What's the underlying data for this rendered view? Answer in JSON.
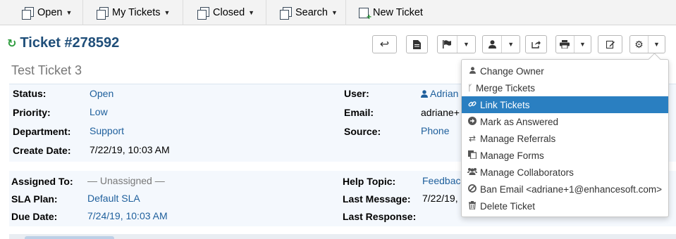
{
  "nav": {
    "open": "Open",
    "my_tickets": "My Tickets",
    "closed": "Closed",
    "search": "Search",
    "new_ticket": "New Ticket"
  },
  "ticket": {
    "number": "Ticket #278592",
    "subject": "Test Ticket 3"
  },
  "details": {
    "status_label": "Status:",
    "status": "Open",
    "priority_label": "Priority:",
    "priority": "Low",
    "department_label": "Department:",
    "department": "Support",
    "create_date_label": "Create Date:",
    "create_date": "7/22/19, 10:03 AM",
    "user_label": "User:",
    "user": "Adrian",
    "email_label": "Email:",
    "email": "adriane+",
    "source_label": "Source:",
    "source": "Phone",
    "assigned_to_label": "Assigned To:",
    "assigned_to": "— Unassigned —",
    "sla_plan_label": "SLA Plan:",
    "sla_plan": "Default SLA",
    "due_date_label": "Due Date:",
    "due_date": "7/24/19, 10:03 AM",
    "help_topic_label": "Help Topic:",
    "help_topic": "Feedbac",
    "last_message_label": "Last Message:",
    "last_message": "7/22/19,",
    "last_response_label": "Last Response:"
  },
  "menu": {
    "items": [
      {
        "label": "Change Owner",
        "icon": "user-icon"
      },
      {
        "label": "Merge Tickets",
        "icon": "merge-icon"
      },
      {
        "label": "Link Tickets",
        "icon": "link-icon"
      },
      {
        "label": "Mark as Answered",
        "icon": "arrow-circle-icon"
      },
      {
        "label": "Manage Referrals",
        "icon": "exchange-icon"
      },
      {
        "label": "Manage Forms",
        "icon": "forms-icon"
      },
      {
        "label": "Manage Collaborators",
        "icon": "group-icon"
      },
      {
        "label": "Ban Email <adriane+1@enhancesoft.com>",
        "icon": "ban-icon"
      },
      {
        "label": "Delete Ticket",
        "icon": "trash-icon"
      }
    ],
    "active_index": 2
  },
  "colors": {
    "accent": "#2a7fc1",
    "title": "#1f4e79",
    "link": "#1e5f9c",
    "panel_bg": "#f4f8fd"
  }
}
